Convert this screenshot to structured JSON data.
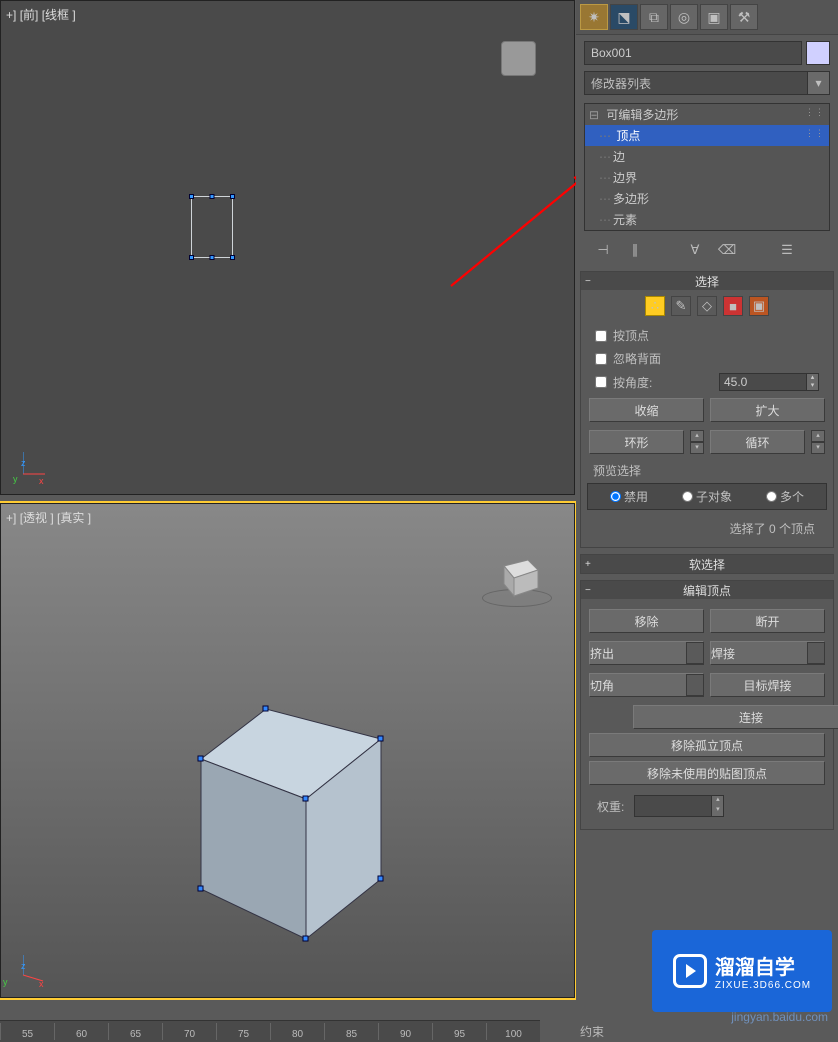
{
  "viewports": {
    "top": {
      "bracket": "+]",
      "name": "[前]",
      "shading": "[线框 ]"
    },
    "bottom": {
      "bracket": "+]",
      "name": "[透视 ]",
      "shading": "[真实 ]"
    }
  },
  "object_name": "Box001",
  "modifier_dropdown": "修改器列表",
  "modifier_stack": {
    "root": "可编辑多边形",
    "items": [
      "顶点",
      "边",
      "边界",
      "多边形",
      "元素"
    ],
    "selected_index": 0
  },
  "rollouts": {
    "selection": {
      "title": "选择",
      "by_vertex": "按顶点",
      "ignore_back": "忽略背面",
      "by_angle": "按角度:",
      "angle_value": "45.0",
      "shrink": "收缩",
      "grow": "扩大",
      "ring": "环形",
      "loop": "循环",
      "preview_label": "预览选择",
      "radios": {
        "none": "禁用",
        "subobj": "子对象",
        "multi": "多个"
      },
      "status": "选择了 0 个顶点"
    },
    "soft_selection": {
      "title": "软选择"
    },
    "edit_vertices": {
      "title": "编辑顶点",
      "remove": "移除",
      "break": "断开",
      "extrude": "挤出",
      "weld": "焊接",
      "chamfer": "切角",
      "target_weld": "目标焊接",
      "connect": "连接",
      "remove_isolated": "移除孤立顶点",
      "remove_unused_map": "移除未使用的贴图顶点",
      "weight": "权重:"
    }
  },
  "watermark": {
    "brand": "溜溜自学",
    "sub": "ZIXUE.3D66.COM",
    "under": "jingyan.baidu.com"
  },
  "timeline": [
    "55",
    "60",
    "65",
    "70",
    "75",
    "80",
    "85",
    "90",
    "95",
    "100"
  ],
  "constraint_label": "约束",
  "axes": {
    "x": "x",
    "y": "y",
    "z": "z"
  }
}
